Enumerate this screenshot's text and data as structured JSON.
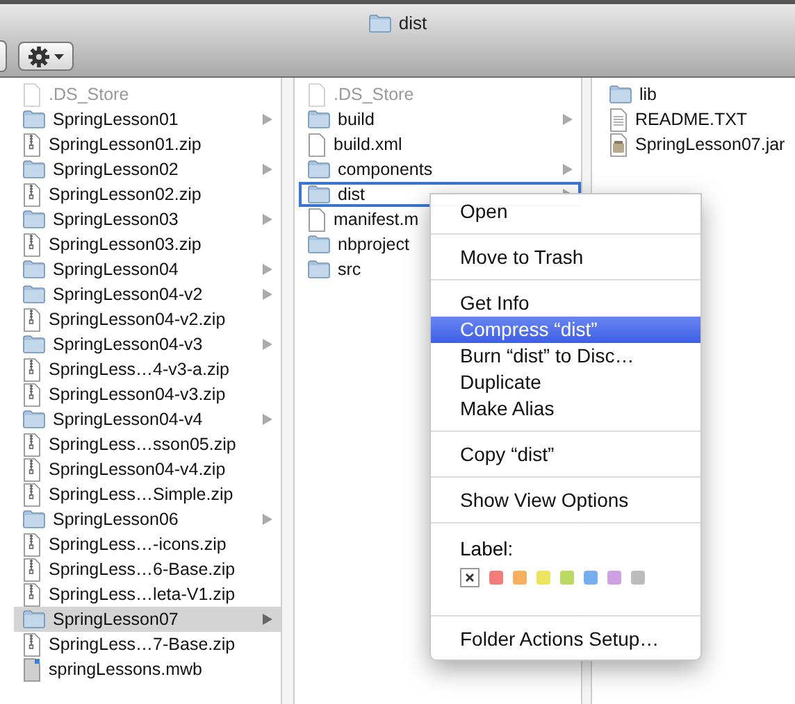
{
  "window": {
    "title": "dist"
  },
  "columns": [
    {
      "items": [
        {
          "name": ".DS_Store",
          "kind": "hidden",
          "has_children": false,
          "selected": false,
          "outlined": false
        },
        {
          "name": "SpringLesson01",
          "kind": "folder",
          "has_children": true,
          "selected": false,
          "outlined": false
        },
        {
          "name": "SpringLesson01.zip",
          "kind": "zip",
          "has_children": false,
          "selected": false,
          "outlined": false
        },
        {
          "name": "SpringLesson02",
          "kind": "folder",
          "has_children": true,
          "selected": false,
          "outlined": false
        },
        {
          "name": "SpringLesson02.zip",
          "kind": "zip",
          "has_children": false,
          "selected": false,
          "outlined": false
        },
        {
          "name": "SpringLesson03",
          "kind": "folder",
          "has_children": true,
          "selected": false,
          "outlined": false
        },
        {
          "name": "SpringLesson03.zip",
          "kind": "zip",
          "has_children": false,
          "selected": false,
          "outlined": false
        },
        {
          "name": "SpringLesson04",
          "kind": "folder",
          "has_children": true,
          "selected": false,
          "outlined": false
        },
        {
          "name": "SpringLesson04-v2",
          "kind": "folder",
          "has_children": true,
          "selected": false,
          "outlined": false
        },
        {
          "name": "SpringLesson04-v2.zip",
          "kind": "zip",
          "has_children": false,
          "selected": false,
          "outlined": false
        },
        {
          "name": "SpringLesson04-v3",
          "kind": "folder",
          "has_children": true,
          "selected": false,
          "outlined": false
        },
        {
          "name": "SpringLess…4-v3-a.zip",
          "kind": "zip",
          "has_children": false,
          "selected": false,
          "outlined": false
        },
        {
          "name": "SpringLesson04-v3.zip",
          "kind": "zip",
          "has_children": false,
          "selected": false,
          "outlined": false
        },
        {
          "name": "SpringLesson04-v4",
          "kind": "folder",
          "has_children": true,
          "selected": false,
          "outlined": false
        },
        {
          "name": "SpringLess…sson05.zip",
          "kind": "zip",
          "has_children": false,
          "selected": false,
          "outlined": false
        },
        {
          "name": "SpringLesson04-v4.zip",
          "kind": "zip",
          "has_children": false,
          "selected": false,
          "outlined": false
        },
        {
          "name": "SpringLess…Simple.zip",
          "kind": "zip",
          "has_children": false,
          "selected": false,
          "outlined": false
        },
        {
          "name": "SpringLesson06",
          "kind": "folder",
          "has_children": true,
          "selected": false,
          "outlined": false
        },
        {
          "name": "SpringLess…-icons.zip",
          "kind": "zip",
          "has_children": false,
          "selected": false,
          "outlined": false
        },
        {
          "name": "SpringLess…6-Base.zip",
          "kind": "zip",
          "has_children": false,
          "selected": false,
          "outlined": false
        },
        {
          "name": "SpringLess…leta-V1.zip",
          "kind": "zip",
          "has_children": false,
          "selected": false,
          "outlined": false
        },
        {
          "name": "SpringLesson07",
          "kind": "folder",
          "has_children": true,
          "selected": true,
          "outlined": false
        },
        {
          "name": "SpringLess…7-Base.zip",
          "kind": "zip",
          "has_children": false,
          "selected": false,
          "outlined": false
        },
        {
          "name": "springLessons.mwb",
          "kind": "mwb",
          "has_children": false,
          "selected": false,
          "outlined": false
        }
      ]
    },
    {
      "items": [
        {
          "name": ".DS_Store",
          "kind": "hidden",
          "has_children": false,
          "selected": false,
          "outlined": false
        },
        {
          "name": "build",
          "kind": "folder",
          "has_children": true,
          "selected": false,
          "outlined": false
        },
        {
          "name": "build.xml",
          "kind": "file",
          "has_children": false,
          "selected": false,
          "outlined": false
        },
        {
          "name": "components",
          "kind": "folder",
          "has_children": true,
          "selected": false,
          "outlined": false
        },
        {
          "name": "dist",
          "kind": "folder",
          "has_children": true,
          "selected": false,
          "outlined": true
        },
        {
          "name": "manifest.m",
          "kind": "file",
          "has_children": false,
          "selected": false,
          "outlined": false
        },
        {
          "name": "nbproject",
          "kind": "folder",
          "selected": false,
          "outlined": false
        },
        {
          "name": "src",
          "kind": "folder",
          "selected": false,
          "outlined": false
        }
      ]
    },
    {
      "items": [
        {
          "name": "lib",
          "kind": "folder",
          "has_children": false,
          "selected": false,
          "outlined": false
        },
        {
          "name": "README.TXT",
          "kind": "text",
          "has_children": false,
          "selected": false,
          "outlined": false
        },
        {
          "name": "SpringLesson07.jar",
          "kind": "jar",
          "has_children": false,
          "selected": false,
          "outlined": false
        }
      ]
    }
  ],
  "context_menu": {
    "items": [
      {
        "kind": "item",
        "label": "Open",
        "selected": false
      },
      {
        "kind": "separator"
      },
      {
        "kind": "item",
        "label": "Move to Trash",
        "selected": false
      },
      {
        "kind": "separator"
      },
      {
        "kind": "item",
        "label": "Get Info",
        "selected": false
      },
      {
        "kind": "item",
        "label": "Compress “dist”",
        "selected": true
      },
      {
        "kind": "item",
        "label": "Burn “dist” to Disc…",
        "selected": false
      },
      {
        "kind": "item",
        "label": "Duplicate",
        "selected": false
      },
      {
        "kind": "item",
        "label": "Make Alias",
        "selected": false
      },
      {
        "kind": "separator"
      },
      {
        "kind": "item",
        "label": "Copy “dist”",
        "selected": false
      },
      {
        "kind": "separator"
      },
      {
        "kind": "item",
        "label": "Show View Options",
        "selected": false
      },
      {
        "kind": "separator"
      },
      {
        "kind": "labels",
        "label": "Label:",
        "colors": [
          {
            "kind": "none"
          },
          {
            "kind": "color",
            "color": "#f07d7a"
          },
          {
            "kind": "color",
            "color": "#f4b05e"
          },
          {
            "kind": "color",
            "color": "#ece35e"
          },
          {
            "kind": "color",
            "color": "#bcd964"
          },
          {
            "kind": "color",
            "color": "#76aef0"
          },
          {
            "kind": "color",
            "color": "#cf9fe4"
          },
          {
            "kind": "color",
            "color": "#bcbcbc"
          }
        ]
      },
      {
        "kind": "separator"
      },
      {
        "kind": "item",
        "label": "Folder Actions Setup…",
        "selected": false
      }
    ]
  }
}
